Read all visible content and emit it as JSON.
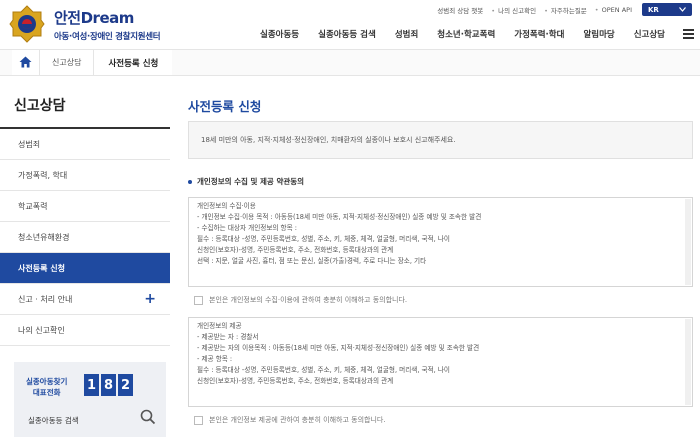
{
  "logo": {
    "title": "안전Dream",
    "subtitle": "아동·여성·장애인 경찰지원센터"
  },
  "util_links": [
    "성범죄 상담 챗봇",
    "나의 신고확인",
    "자주하는질문",
    "OPEN API"
  ],
  "language": {
    "selected": "KR"
  },
  "gnb": [
    "실종아동등",
    "실종아동등 검색",
    "성범죄",
    "청소년·학교폭력",
    "가정폭력·학대",
    "알림마당",
    "신고상담"
  ],
  "breadcrumb": {
    "parent": "신고상담",
    "current": "사전등록 신청"
  },
  "sidebar": {
    "title": "신고상담",
    "items": [
      {
        "label": "성범죄"
      },
      {
        "label": "가정폭력, 학대"
      },
      {
        "label": "학교폭력"
      },
      {
        "label": "청소년유해환경"
      },
      {
        "label": "사전등록 신청"
      },
      {
        "label": "신고 · 처리 안내"
      },
      {
        "label": "나의 신고확인"
      }
    ],
    "expand_icon": "+",
    "hotline": {
      "line1": "실종아동찾기",
      "line2": "대표전화",
      "digits": [
        "1",
        "8",
        "2"
      ]
    },
    "search_label": "실종아동등 검색"
  },
  "main": {
    "title": "사전등록 신청",
    "notice": "18세 미만의 아동, 지적·지체성·정신장애인, 치매환자의 실종이나 보호시 신고해주세요.",
    "section_title": "개인정보의 수집 및 제공 약관동의",
    "terms1": [
      "개인정보의 수집·이용",
      "- 개인정보 수집·이용 목적 : 아동등(18세 미만 아동, 지적·지체성·정신장애인) 실종 예방 및 조속한 발견",
      "- 수집하는 대상자 개인정보의 항목 :",
      "  필수 : 등록대상 -성명, 주민등록번호, 성별, 주소, 키, 체중, 체격, 얼굴형, 머리색, 국적, 나이",
      "        신청인(보호자)-성명, 주민등록번호, 주소, 전화번호, 등록대상과의 관계",
      "  선택 : 지문, 얼굴 사진, 흉터, 점 또는 문신, 실종(가출)경력, 주로 다니는 장소, 기타"
    ],
    "agree1": "본인은 개인정보의 수집·이용에 관하여 충분히 이해하고 동의합니다.",
    "terms2": [
      "개인정보의 제공",
      "- 제공받는 자 : 경찰서",
      "- 제공받는 자의 이용목적 : 아동등(18세 미만 아동, 지적·지체성·정신장애인) 실종 예방 및 조속한 발견",
      "- 제공 항목 :",
      "  필수 : 등록대상 -성명, 주민등록번호, 성별, 주소, 키, 체중, 체격, 얼굴형, 머리색, 국적, 나이",
      "        신청인(보호자)-성명, 주민등록번호, 주소, 전화번호, 등록대상과의 관계"
    ],
    "agree2": "본인은 개인정보 제공에 관하여 충분히 이해하고 동의합니다."
  },
  "colors": {
    "primary": "#1f4aa0",
    "logo": "#1d3a8a"
  }
}
